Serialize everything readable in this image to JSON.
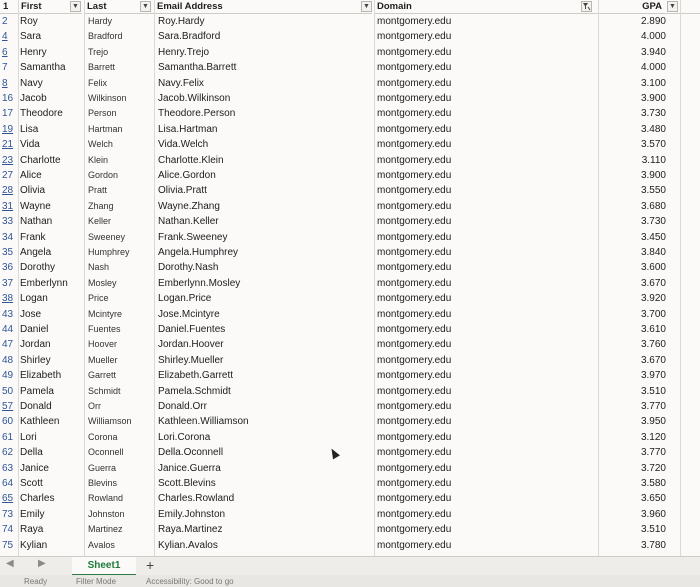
{
  "headers": {
    "first": "First",
    "last": "Last",
    "email": "Email Address",
    "domain": "Domain",
    "gpa": "GPA"
  },
  "header_row_number": "1",
  "rows": [
    {
      "num": "2",
      "first": "Roy",
      "last": "Hardy",
      "email": "Roy.Hardy",
      "domain": "montgomery.edu",
      "gpa": "2.890"
    },
    {
      "num": "4",
      "first": "Sara",
      "last": "Bradford",
      "email": "Sara.Bradford",
      "domain": "montgomery.edu",
      "gpa": "4.000"
    },
    {
      "num": "6",
      "first": "Henry",
      "last": "Trejo",
      "email": "Henry.Trejo",
      "domain": "montgomery.edu",
      "gpa": "3.940"
    },
    {
      "num": "7",
      "first": "Samantha",
      "last": "Barrett",
      "email": "Samantha.Barrett",
      "domain": "montgomery.edu",
      "gpa": "4.000"
    },
    {
      "num": "8",
      "first": "Navy",
      "last": "Felix",
      "email": "Navy.Felix",
      "domain": "montgomery.edu",
      "gpa": "3.100"
    },
    {
      "num": "16",
      "first": "Jacob",
      "last": "Wilkinson",
      "email": "Jacob.Wilkinson",
      "domain": "montgomery.edu",
      "gpa": "3.900"
    },
    {
      "num": "17",
      "first": "Theodore",
      "last": "Person",
      "email": "Theodore.Person",
      "domain": "montgomery.edu",
      "gpa": "3.730"
    },
    {
      "num": "19",
      "first": "Lisa",
      "last": "Hartman",
      "email": "Lisa.Hartman",
      "domain": "montgomery.edu",
      "gpa": "3.480"
    },
    {
      "num": "21",
      "first": "Vida",
      "last": "Welch",
      "email": "Vida.Welch",
      "domain": "montgomery.edu",
      "gpa": "3.570"
    },
    {
      "num": "23",
      "first": "Charlotte",
      "last": "Klein",
      "email": "Charlotte.Klein",
      "domain": "montgomery.edu",
      "gpa": "3.110"
    },
    {
      "num": "27",
      "first": "Alice",
      "last": "Gordon",
      "email": "Alice.Gordon",
      "domain": "montgomery.edu",
      "gpa": "3.900"
    },
    {
      "num": "28",
      "first": "Olivia",
      "last": "Pratt",
      "email": "Olivia.Pratt",
      "domain": "montgomery.edu",
      "gpa": "3.550"
    },
    {
      "num": "31",
      "first": "Wayne",
      "last": "Zhang",
      "email": "Wayne.Zhang",
      "domain": "montgomery.edu",
      "gpa": "3.680"
    },
    {
      "num": "33",
      "first": "Nathan",
      "last": "Keller",
      "email": "Nathan.Keller",
      "domain": "montgomery.edu",
      "gpa": "3.730"
    },
    {
      "num": "34",
      "first": "Frank",
      "last": "Sweeney",
      "email": "Frank.Sweeney",
      "domain": "montgomery.edu",
      "gpa": "3.450"
    },
    {
      "num": "35",
      "first": "Angela",
      "last": "Humphrey",
      "email": "Angela.Humphrey",
      "domain": "montgomery.edu",
      "gpa": "3.840"
    },
    {
      "num": "36",
      "first": "Dorothy",
      "last": "Nash",
      "email": "Dorothy.Nash",
      "domain": "montgomery.edu",
      "gpa": "3.600"
    },
    {
      "num": "37",
      "first": "Emberlynn",
      "last": "Mosley",
      "email": "Emberlynn.Mosley",
      "domain": "montgomery.edu",
      "gpa": "3.670"
    },
    {
      "num": "38",
      "first": "Logan",
      "last": "Price",
      "email": "Logan.Price",
      "domain": "montgomery.edu",
      "gpa": "3.920"
    },
    {
      "num": "43",
      "first": "Jose",
      "last": "Mcintyre",
      "email": "Jose.Mcintyre",
      "domain": "montgomery.edu",
      "gpa": "3.700"
    },
    {
      "num": "44",
      "first": "Daniel",
      "last": "Fuentes",
      "email": "Daniel.Fuentes",
      "domain": "montgomery.edu",
      "gpa": "3.610"
    },
    {
      "num": "47",
      "first": "Jordan",
      "last": "Hoover",
      "email": "Jordan.Hoover",
      "domain": "montgomery.edu",
      "gpa": "3.760"
    },
    {
      "num": "48",
      "first": "Shirley",
      "last": "Mueller",
      "email": "Shirley.Mueller",
      "domain": "montgomery.edu",
      "gpa": "3.670"
    },
    {
      "num": "49",
      "first": "Elizabeth",
      "last": "Garrett",
      "email": "Elizabeth.Garrett",
      "domain": "montgomery.edu",
      "gpa": "3.970"
    },
    {
      "num": "50",
      "first": "Pamela",
      "last": "Schmidt",
      "email": "Pamela.Schmidt",
      "domain": "montgomery.edu",
      "gpa": "3.510"
    },
    {
      "num": "57",
      "first": "Donald",
      "last": "Orr",
      "email": "Donald.Orr",
      "domain": "montgomery.edu",
      "gpa": "3.770"
    },
    {
      "num": "60",
      "first": "Kathleen",
      "last": "Williamson",
      "email": "Kathleen.Williamson",
      "domain": "montgomery.edu",
      "gpa": "3.950"
    },
    {
      "num": "61",
      "first": "Lori",
      "last": "Corona",
      "email": "Lori.Corona",
      "domain": "montgomery.edu",
      "gpa": "3.120"
    },
    {
      "num": "62",
      "first": "Della",
      "last": "Oconnell",
      "email": "Della.Oconnell",
      "domain": "montgomery.edu",
      "gpa": "3.770"
    },
    {
      "num": "63",
      "first": "Janice",
      "last": "Guerra",
      "email": "Janice.Guerra",
      "domain": "montgomery.edu",
      "gpa": "3.720"
    },
    {
      "num": "64",
      "first": "Scott",
      "last": "Blevins",
      "email": "Scott.Blevins",
      "domain": "montgomery.edu",
      "gpa": "3.580"
    },
    {
      "num": "65",
      "first": "Charles",
      "last": "Rowland",
      "email": "Charles.Rowland",
      "domain": "montgomery.edu",
      "gpa": "3.650"
    },
    {
      "num": "73",
      "first": "Emily",
      "last": "Johnston",
      "email": "Emily.Johnston",
      "domain": "montgomery.edu",
      "gpa": "3.960"
    },
    {
      "num": "74",
      "first": "Raya",
      "last": "Martinez",
      "email": "Raya.Martinez",
      "domain": "montgomery.edu",
      "gpa": "3.510"
    },
    {
      "num": "75",
      "first": "Kylian",
      "last": "Avalos",
      "email": "Kylian.Avalos",
      "domain": "montgomery.edu",
      "gpa": "3.780"
    }
  ],
  "sheet_tab": "Sheet1",
  "add_sheet_label": "+",
  "status": {
    "ready": "Ready",
    "filter_mode": "Filter Mode",
    "accessibility": "Accessibility: Good to go"
  },
  "icons": {
    "filter_dropdown": "▼",
    "filter_active": "filter-active-icon",
    "prev_sheet": "◀",
    "next_sheet": "▶"
  },
  "colors": {
    "sheet_tab_accent": "#1f7a3b",
    "row_number": "#2f5597"
  }
}
